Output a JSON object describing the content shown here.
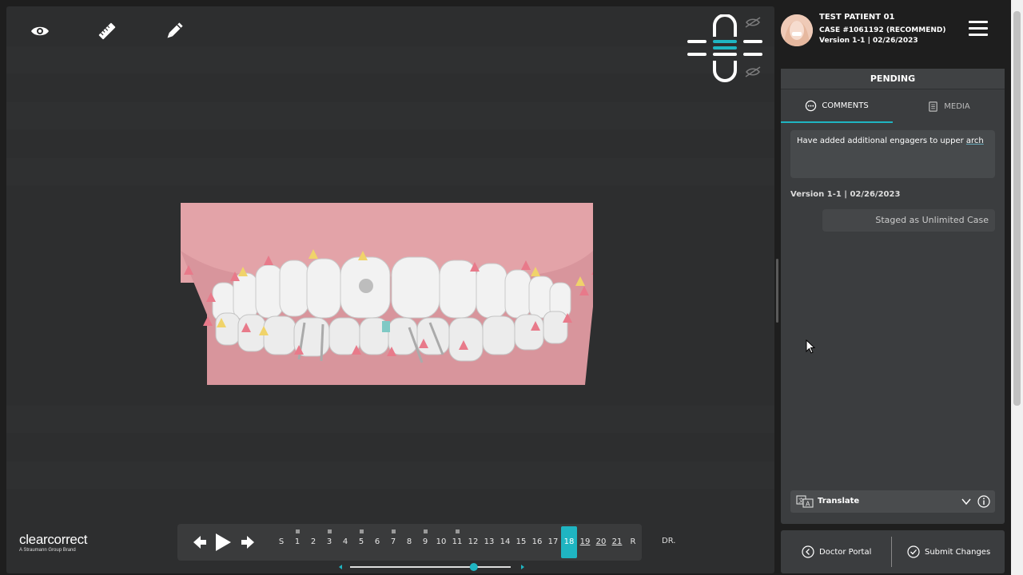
{
  "toolbar": {
    "view_icon": "eye-icon",
    "measure_icon": "ruler-icon",
    "edit_icon": "pencil-icon"
  },
  "brand": {
    "name": "clearcorrect",
    "tagline": "A Straumann Group Brand"
  },
  "timeline": {
    "stages": [
      {
        "label": "S",
        "marker": false,
        "active": false,
        "underline": false
      },
      {
        "label": "1",
        "marker": true,
        "active": false,
        "underline": false
      },
      {
        "label": "2",
        "marker": false,
        "active": false,
        "underline": false
      },
      {
        "label": "3",
        "marker": true,
        "active": false,
        "underline": false
      },
      {
        "label": "4",
        "marker": false,
        "active": false,
        "underline": false
      },
      {
        "label": "5",
        "marker": true,
        "active": false,
        "underline": false
      },
      {
        "label": "6",
        "marker": false,
        "active": false,
        "underline": false
      },
      {
        "label": "7",
        "marker": true,
        "active": false,
        "underline": false
      },
      {
        "label": "8",
        "marker": false,
        "active": false,
        "underline": false
      },
      {
        "label": "9",
        "marker": true,
        "active": false,
        "underline": false
      },
      {
        "label": "10",
        "marker": false,
        "active": false,
        "underline": false
      },
      {
        "label": "11",
        "marker": true,
        "active": false,
        "underline": false
      },
      {
        "label": "12",
        "marker": false,
        "active": false,
        "underline": false
      },
      {
        "label": "13",
        "marker": false,
        "active": false,
        "underline": false
      },
      {
        "label": "14",
        "marker": false,
        "active": false,
        "underline": false
      },
      {
        "label": "15",
        "marker": false,
        "active": false,
        "underline": false
      },
      {
        "label": "16",
        "marker": false,
        "active": false,
        "underline": false
      },
      {
        "label": "17",
        "marker": false,
        "active": false,
        "underline": false
      },
      {
        "label": "18",
        "marker": false,
        "active": true,
        "underline": false
      },
      {
        "label": "19",
        "marker": false,
        "active": false,
        "underline": true
      },
      {
        "label": "20",
        "marker": false,
        "active": false,
        "underline": true
      },
      {
        "label": "21",
        "marker": false,
        "active": false,
        "underline": true
      },
      {
        "label": "R",
        "marker": false,
        "active": false,
        "underline": false
      }
    ],
    "dr_label": "DR.",
    "slider_value": 0.77
  },
  "patient": {
    "name": "TEST PATIENT 01",
    "case": "CASE #1061192 (RECOMMEND)",
    "version": "Version 1-1 | 02/26/2023"
  },
  "panel": {
    "status": "PENDING",
    "tabs": {
      "comments": "COMMENTS",
      "media": "MEDIA"
    },
    "comment_part1": "Have added additional engagers to upper ",
    "comment_part2": "arch",
    "version_label": "Version 1-1 | 02/26/2023",
    "staged_message": "Staged as Unlimited Case",
    "translate_label": "Translate"
  },
  "actions": {
    "doctor_portal": "Doctor Portal",
    "submit_changes": "Submit Changes"
  },
  "colors": {
    "accent": "#1fb5c2",
    "attach_pink": "#e87a8a",
    "attach_yellow": "#f0d36a"
  }
}
